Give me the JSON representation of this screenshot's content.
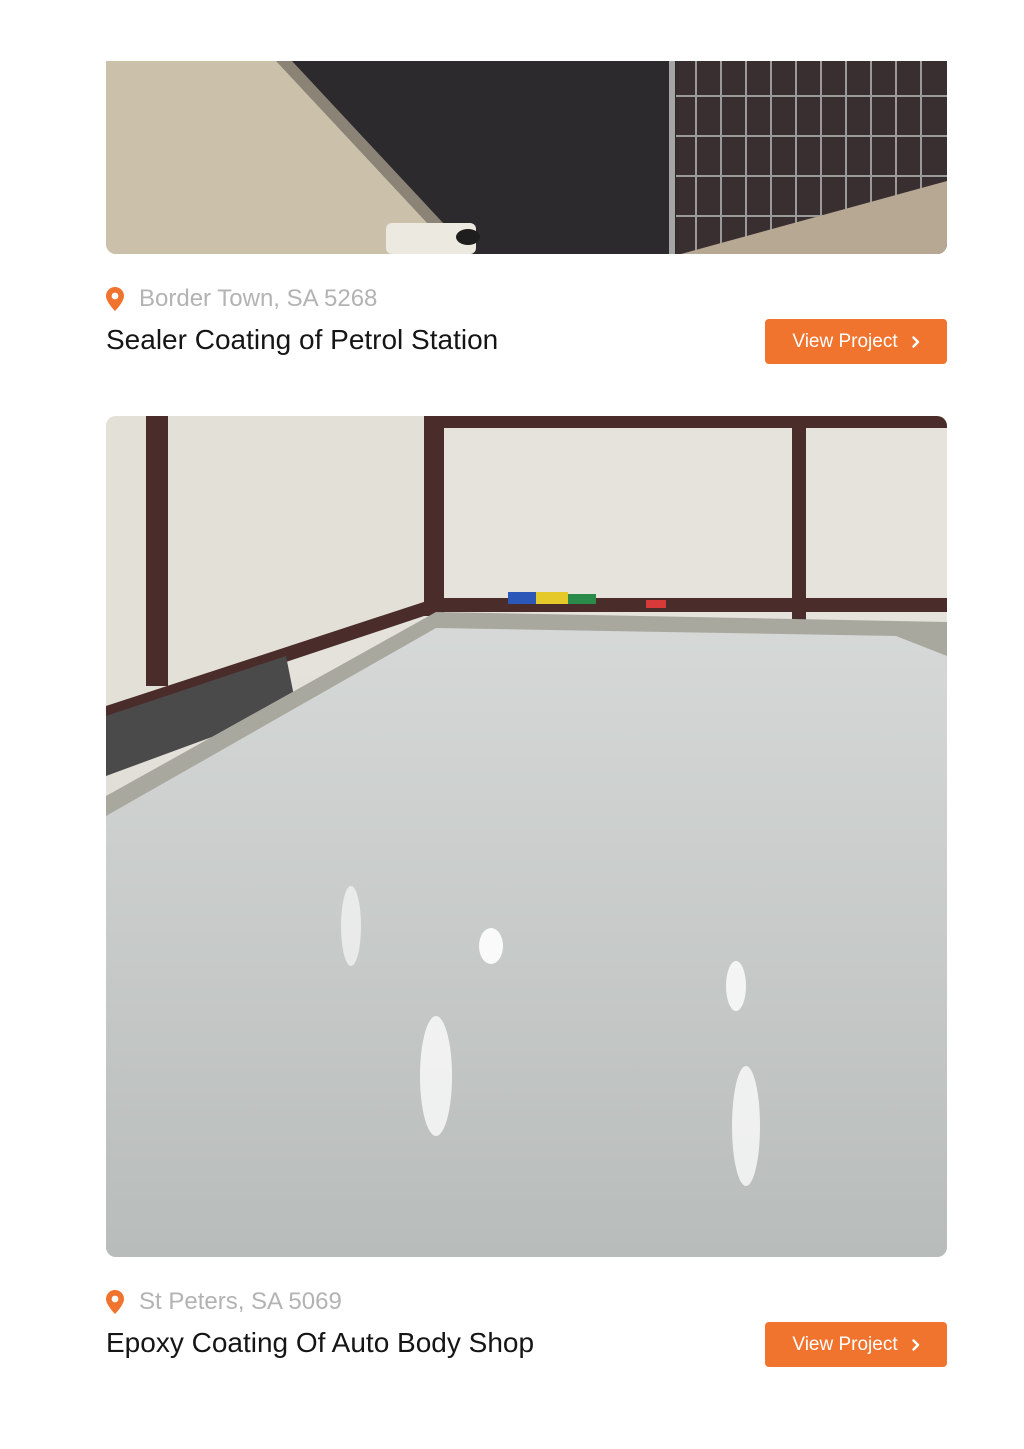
{
  "projects": [
    {
      "location": "Border Town, SA 5268",
      "title": "Sealer Coating of Petrol Station",
      "button_label": "View Project"
    },
    {
      "location": "St Peters, SA 5069",
      "title": "Epoxy Coating Of Auto Body Shop",
      "button_label": "View Project"
    }
  ],
  "icons": {
    "location": "map-pin-icon",
    "button": "chevron-right-icon"
  },
  "colors": {
    "accent": "#f0732e",
    "location_text": "#b3b3b3",
    "title_text": "#151515"
  }
}
